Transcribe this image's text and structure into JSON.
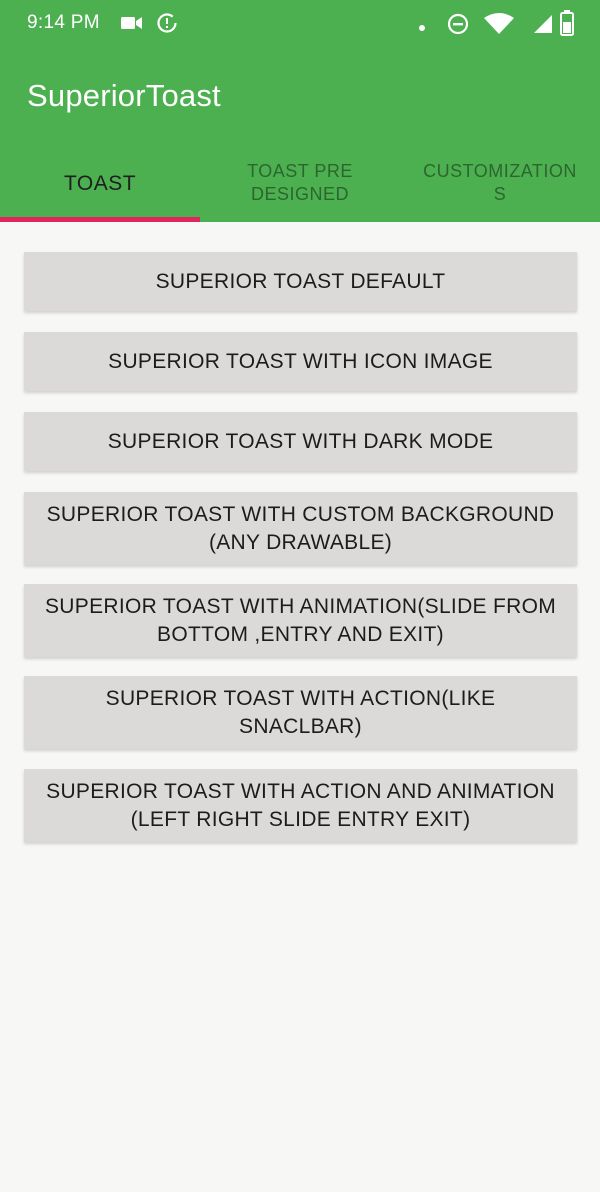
{
  "status_bar": {
    "time": "9:14 PM",
    "icons": [
      "video-camera-icon",
      "data-saver-icon",
      "dot-icon",
      "do-not-disturb-icon",
      "wifi-icon",
      "cellular-signal-icon",
      "battery-icon"
    ]
  },
  "app_bar": {
    "title": "SuperiorToast"
  },
  "tabs": [
    {
      "label": "TOAST",
      "selected": true
    },
    {
      "label": "TOAST PRE DESIGNED",
      "selected": false
    },
    {
      "label": "CUSTOMIZATIONS",
      "selected": false
    }
  ],
  "buttons": [
    {
      "label": "SUPERIOR TOAST DEFAULT"
    },
    {
      "label": "SUPERIOR TOAST WITH ICON IMAGE"
    },
    {
      "label": "SUPERIOR TOAST WITH DARK MODE"
    },
    {
      "label": "SUPERIOR TOAST WITH CUSTOM BACKGROUND (ANY DRAWABLE)"
    },
    {
      "label": "SUPERIOR TOAST WITH ANIMATION(SLIDE FROM BOTTOM ,ENTRY AND EXIT)"
    },
    {
      "label": "SUPERIOR TOAST WITH ACTION(LIKE SNACLBAR)"
    },
    {
      "label": "SUPERIOR TOAST WITH ACTION AND ANIMATION (LEFT RIGHT SLIDE ENTRY EXIT)"
    }
  ],
  "colors": {
    "primary": "#4caf50",
    "tab_indicator": "#e0245e",
    "button_background": "#dbdad8",
    "page_background": "#f7f7f5"
  }
}
